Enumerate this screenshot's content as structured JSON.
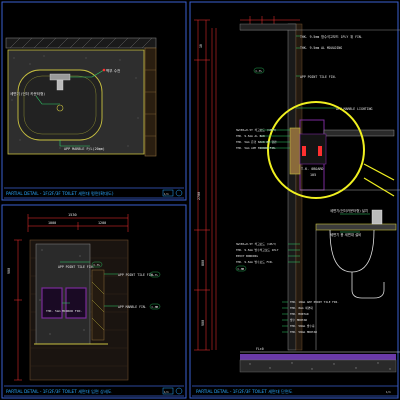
{
  "colors": {
    "background": "#000000",
    "frame": "#3a5fd0",
    "title_text": "#2aa8ff",
    "dimension": "#ff3030",
    "label_text": "#e6e6e6",
    "leader_green": "#2fd06a",
    "highlight": "#f0f020",
    "marble": "#3c3c3c",
    "tile": "#6a4a2a",
    "mirror": "#7a2a9a",
    "floor_purple": "#6a3aa8",
    "counter_outline": "#c8c040"
  },
  "panels": {
    "top_left": {
      "title": "PARTIAL DETAIL - 1F/2F/3F TOILET 세면대 평면(확대도)",
      "labels": {
        "faucet": "벽부 수전",
        "bowl": "세면기 (언더 카운터형)",
        "marble": "APP MARBLE P/L(20mm)"
      }
    },
    "bottom_left": {
      "title": "PARTIAL DETAIL - 1F/2F/3F TOILET 세면대 입면 상세도",
      "dims": [
        "1530",
        "1000",
        "1200",
        "900"
      ],
      "labels": {
        "tile_top": "APP POINT TILE FIN.",
        "marble": "APP MARBLE FIN.",
        "mirror": "THK. 5mm MIRROR FIN.",
        "tile_right": "APP POINT TILE FIN.",
        "marble_right": "APP MARBLE FIN."
      },
      "tags": [
        "C-MB",
        "C-TL",
        "C-MR",
        "C-MB"
      ]
    },
    "right": {
      "title": "PARTIAL DETAIL - 1F/2F/3F TOILET 세면대 단면도",
      "top_labels": [
        "THK. 9.5mm 방수석고보드 1PLY 위 FIN.",
        "THK. 9.5mm AL MOULDING",
        "APP POINT TILE FIN.",
        "APP MARBLE LIGHTING"
      ],
      "circle_labels": [
        "SW=BS+0.5T 석고보드 (1PLY)",
        "THK. 9.5mm AL BAR",
        "THK. 5mm 은경 BACK 8T 합판",
        "THK. 5mm APP MIRROR FIN."
      ],
      "circle_text": [
        "T.K. 0BOARD",
        "105"
      ],
      "right_labels": [
        "세면기(언더카운터형) 설치",
        "세면기 용 세면대 설비"
      ],
      "mid_labels": [
        "SW=BS+0.5T 석고보드 (1PLY)",
        "THK. 9.5mm 방수석고보드 1PLY",
        "EPOXY BONDING",
        "THK. 9.5mm 방수보드 FIN."
      ],
      "floor_labels": [
        "THK. 10mm APP POINT TILE FIN.",
        "THK. 8mm 세면대",
        "THK. MORTAR",
        "방수 MORTAR",
        "THK. 50mm 방수층",
        "THK. 50mm MORTAR"
      ],
      "floor_mark": "FL±0",
      "dims_vertical": [
        "10",
        "2700",
        "800",
        "900"
      ],
      "tags": [
        "C-TL",
        "C-MB",
        "C-MB",
        "C-TL"
      ]
    }
  },
  "sheet_marks": [
    "1/1",
    "1/1",
    "1/1"
  ]
}
